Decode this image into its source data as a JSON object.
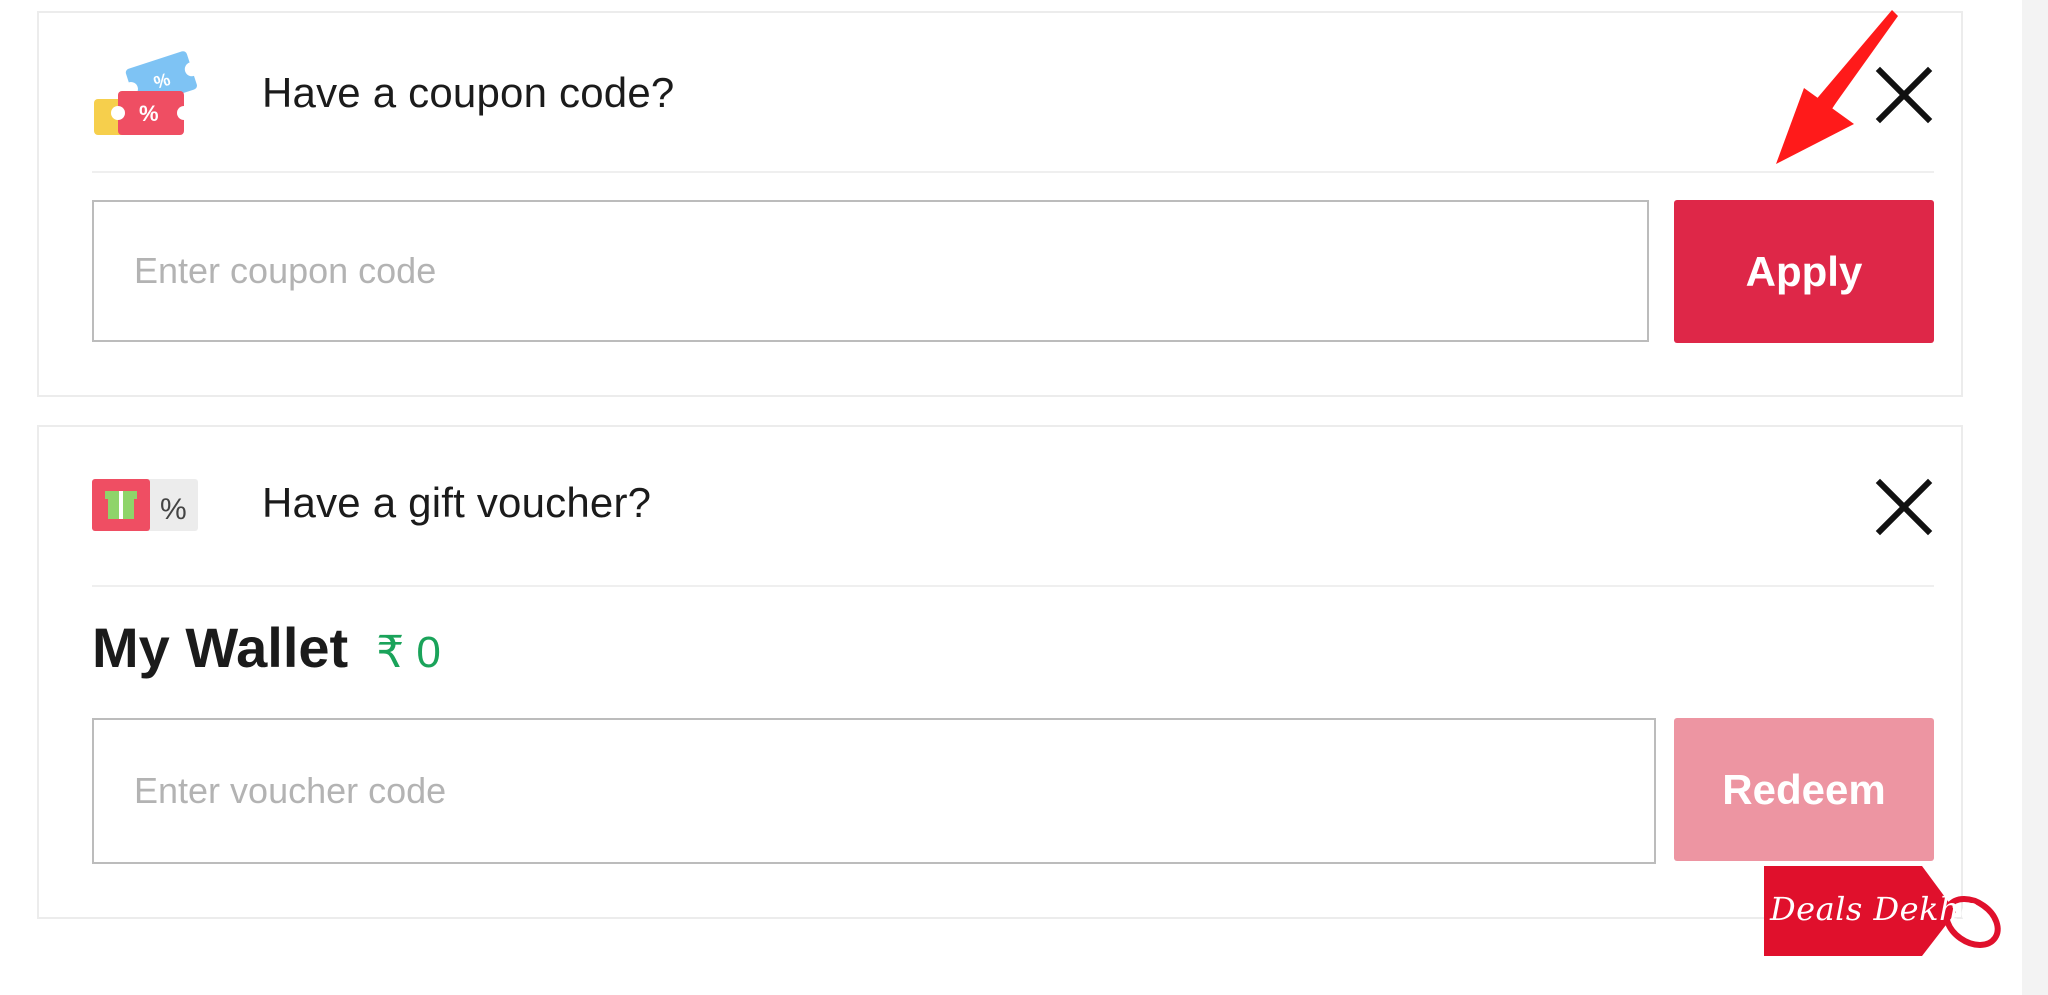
{
  "coupon": {
    "title": "Have a coupon code?",
    "input_placeholder": "Enter coupon code",
    "apply_label": "Apply",
    "icon": "coupon-tickets-icon",
    "close_icon": "close-icon"
  },
  "voucher": {
    "title": "Have a gift voucher?",
    "icon": "gift-voucher-icon",
    "close_icon": "close-icon",
    "wallet_label": "My Wallet",
    "wallet_amount": "₹ 0",
    "input_placeholder": "Enter voucher code",
    "redeem_label": "Redeem"
  },
  "annotation": {
    "arrow_color": "#ff1a1a",
    "watermark_text": "Deals Dekho",
    "watermark_color": "#e0102c"
  },
  "colors": {
    "apply": "#de2748",
    "redeem": "#ed95a2",
    "wallet_amount": "#1aa35a"
  }
}
